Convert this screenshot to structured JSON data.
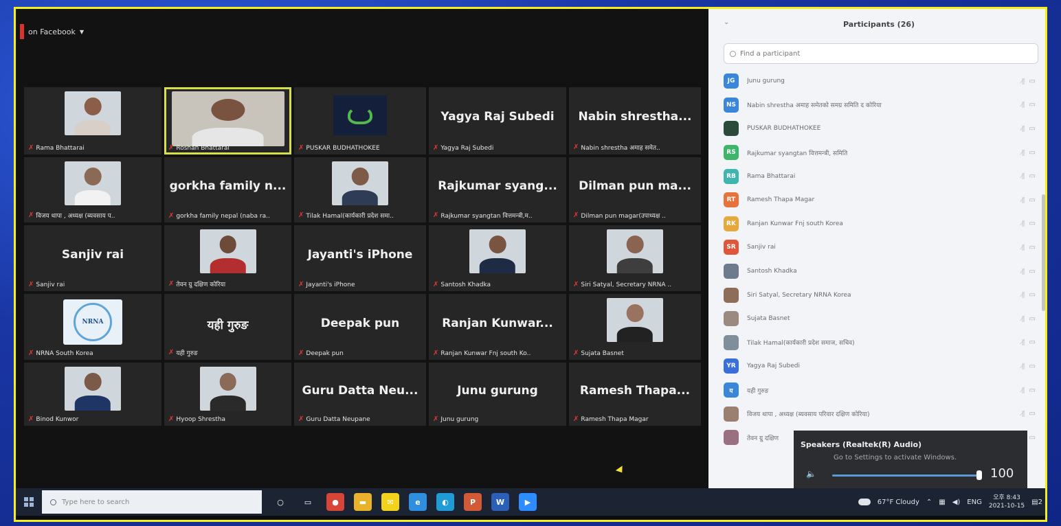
{
  "meeting": {
    "live_label": "on Facebook",
    "tiles": [
      {
        "big": "",
        "caption": "Rama Bhattarai",
        "kind": "photo",
        "skin": "#8a5e48",
        "shirt": "#d8d0c8"
      },
      {
        "big": "",
        "caption": "Roshan Bhattarai",
        "kind": "photo-active",
        "skin": "#7a5240",
        "shirt": "#e6e6e6"
      },
      {
        "big": "",
        "caption": "PUSKAR BUDHATHOKEE",
        "kind": "logo"
      },
      {
        "big": "Yagya Raj Subedi",
        "caption": "Yagya Raj Subedi",
        "kind": "text"
      },
      {
        "big": "Nabin shrestha...",
        "caption": "Nabin shrestha अमाह समेत..",
        "kind": "text"
      },
      {
        "big": "",
        "caption": "विजय थापा , अध्यक्ष (ब्यवसाय प..",
        "kind": "photo",
        "skin": "#8b6a55",
        "shirt": "#f2f2f2"
      },
      {
        "big": "gorkha family n...",
        "caption": "gorkha family nepal (naba ra..",
        "kind": "text"
      },
      {
        "big": "",
        "caption": "Tilak Hamal(कार्यकारी प्रदेश समा..",
        "kind": "photo",
        "skin": "#7d5b48",
        "shirt": "#2f3c55"
      },
      {
        "big": "Rajkumar syang...",
        "caption": "Rajkumar syangtan वित्तमन्त्री,म..",
        "kind": "text"
      },
      {
        "big": "Dilman pun ma...",
        "caption": "Dilman pun magar(उपाध्यक्ष ..",
        "kind": "text"
      },
      {
        "big": "Sanjiv rai",
        "caption": "Sanjiv rai",
        "kind": "text"
      },
      {
        "big": "",
        "caption": "तेवन ग्रु दक्षिण कोरिया",
        "kind": "photo",
        "skin": "#6d4a3a",
        "shirt": "#b32e2e"
      },
      {
        "big": "Jayanti's iPhone",
        "caption": "Jayanti's iPhone",
        "kind": "text"
      },
      {
        "big": "",
        "caption": "Santosh Khadka",
        "kind": "photo",
        "skin": "#7a5443",
        "shirt": "#1d2b44"
      },
      {
        "big": "",
        "caption": "Siri Satyal, Secretary NRNA ..",
        "kind": "photo",
        "skin": "#8a6450",
        "shirt": "#3e3e3e"
      },
      {
        "big": "",
        "caption": "NRNA South Korea",
        "kind": "nrna"
      },
      {
        "big": "यही गुरुङ",
        "caption": "यही गुरुङ",
        "kind": "text"
      },
      {
        "big": "Deepak pun",
        "caption": "Deepak pun",
        "kind": "text"
      },
      {
        "big": "Ranjan Kunwar...",
        "caption": "Ranjan Kunwar Fnj south Ko..",
        "kind": "text"
      },
      {
        "big": "",
        "caption": "Sujata Basnet",
        "kind": "photo",
        "skin": "#9a7360",
        "shirt": "#222222"
      },
      {
        "big": "",
        "caption": "Binod Kunwor",
        "kind": "photo",
        "skin": "#7b5a4a",
        "shirt": "#1e3566"
      },
      {
        "big": "",
        "caption": "Hyoop Shrestha",
        "kind": "photo",
        "skin": "#8c6a58",
        "shirt": "#2a2a2a"
      },
      {
        "big": "Guru Datta Neu...",
        "caption": "Guru Datta Neupane",
        "kind": "text"
      },
      {
        "big": "Junu gurung",
        "caption": "Junu gurung",
        "kind": "text"
      },
      {
        "big": "Ramesh Thapa...",
        "caption": "Ramesh Thapa Magar",
        "kind": "text"
      }
    ]
  },
  "panel": {
    "title": "Participants (26)",
    "search_placeholder": "Find a participant",
    "participants": [
      {
        "initials": "JG",
        "color": "#3a86d8",
        "name": "Junu gurung"
      },
      {
        "initials": "NS",
        "color": "#3a86d8",
        "name": "Nabin shrestha अमाह समेतको समग्र समिति द कोरिया"
      },
      {
        "initials": "",
        "color": "#2c4a3a",
        "name": "PUSKAR BUDHATHOKEE"
      },
      {
        "initials": "RS",
        "color": "#3fb56b",
        "name": "Rajkumar syangtan वित्तमन्त्री, समिति"
      },
      {
        "initials": "RB",
        "color": "#3fb5b0",
        "name": "Rama Bhattarai"
      },
      {
        "initials": "RT",
        "color": "#e6733a",
        "name": "Ramesh Thapa Magar"
      },
      {
        "initials": "RK",
        "color": "#e6a83a",
        "name": "Ranjan Kunwar Fnj south Korea"
      },
      {
        "initials": "SR",
        "color": "#e0563a",
        "name": "Sanjiv rai"
      },
      {
        "initials": "",
        "color": "#6e7a8e",
        "name": "Santosh Khadka"
      },
      {
        "initials": "",
        "color": "#8e6e5a",
        "name": "Siri Satyal, Secretary NRNA Korea"
      },
      {
        "initials": "",
        "color": "#9a8a80",
        "name": "Sujata Basnet"
      },
      {
        "initials": "",
        "color": "#7e8e9a",
        "name": "Tilak Hamal(कार्यकारी प्रदेश समाज, सचिव)"
      },
      {
        "initials": "YR",
        "color": "#3a6ed8",
        "name": "Yagya Raj Subedi"
      },
      {
        "initials": "य",
        "color": "#3a86d8",
        "name": "यही गुरुङ"
      },
      {
        "initials": "",
        "color": "#9a8070",
        "name": "विजय थापा , अध्यक्ष (ब्यवसाय परिवार दक्षिण कोरिया)"
      },
      {
        "initials": "",
        "color": "#9a7080",
        "name": "तेवन ग्रु दक्षिण"
      }
    ]
  },
  "speaker_popup": {
    "label": "Speakers (Realtek(R) Audio)",
    "watermark": "Go to Settings to activate Windows.",
    "volume": "100",
    "volume_fraction": 1.0
  },
  "taskbar": {
    "search_placeholder": "Type here to search",
    "weather": "67°F Cloudy",
    "lang": "ENG",
    "time": "오후 8:43",
    "date": "2021-10-15",
    "notifications": "2",
    "apps": [
      {
        "icon": "cortana-icon",
        "color": "#1c2433",
        "glyph": "○"
      },
      {
        "icon": "task-view-icon",
        "color": "#1c2433",
        "glyph": "▭"
      },
      {
        "icon": "chrome-icon",
        "color": "#d64535",
        "glyph": "●"
      },
      {
        "icon": "file-explorer-icon",
        "color": "#e8b32a",
        "glyph": "▬"
      },
      {
        "icon": "kakaotalk-icon",
        "color": "#f3d21e",
        "glyph": "✉"
      },
      {
        "icon": "ie-icon",
        "color": "#2f8ee0",
        "glyph": "e"
      },
      {
        "icon": "edge-icon",
        "color": "#1f9bd6",
        "glyph": "◐"
      },
      {
        "icon": "powerpoint-icon",
        "color": "#d25a36",
        "glyph": "P"
      },
      {
        "icon": "word-icon",
        "color": "#2b5fb8",
        "glyph": "W"
      },
      {
        "icon": "zoom-icon",
        "color": "#2d8cff",
        "glyph": "▶"
      }
    ]
  }
}
